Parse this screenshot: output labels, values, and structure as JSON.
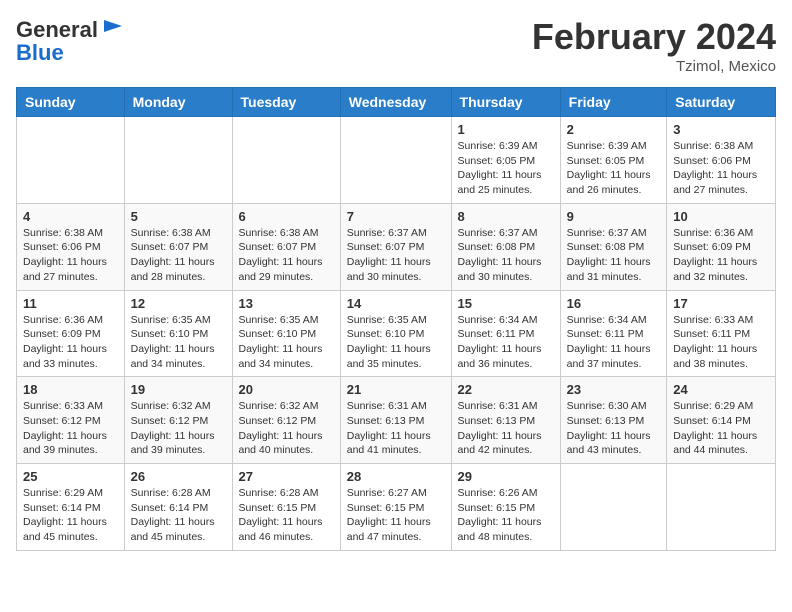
{
  "header": {
    "logo_general": "General",
    "logo_blue": "Blue",
    "month_title": "February 2024",
    "location": "Tzimol, Mexico"
  },
  "days_of_week": [
    "Sunday",
    "Monday",
    "Tuesday",
    "Wednesday",
    "Thursday",
    "Friday",
    "Saturday"
  ],
  "weeks": [
    [
      {
        "day": "",
        "content": ""
      },
      {
        "day": "",
        "content": ""
      },
      {
        "day": "",
        "content": ""
      },
      {
        "day": "",
        "content": ""
      },
      {
        "day": "1",
        "content": "Sunrise: 6:39 AM\nSunset: 6:05 PM\nDaylight: 11 hours and 25 minutes."
      },
      {
        "day": "2",
        "content": "Sunrise: 6:39 AM\nSunset: 6:05 PM\nDaylight: 11 hours and 26 minutes."
      },
      {
        "day": "3",
        "content": "Sunrise: 6:38 AM\nSunset: 6:06 PM\nDaylight: 11 hours and 27 minutes."
      }
    ],
    [
      {
        "day": "4",
        "content": "Sunrise: 6:38 AM\nSunset: 6:06 PM\nDaylight: 11 hours and 27 minutes."
      },
      {
        "day": "5",
        "content": "Sunrise: 6:38 AM\nSunset: 6:07 PM\nDaylight: 11 hours and 28 minutes."
      },
      {
        "day": "6",
        "content": "Sunrise: 6:38 AM\nSunset: 6:07 PM\nDaylight: 11 hours and 29 minutes."
      },
      {
        "day": "7",
        "content": "Sunrise: 6:37 AM\nSunset: 6:07 PM\nDaylight: 11 hours and 30 minutes."
      },
      {
        "day": "8",
        "content": "Sunrise: 6:37 AM\nSunset: 6:08 PM\nDaylight: 11 hours and 30 minutes."
      },
      {
        "day": "9",
        "content": "Sunrise: 6:37 AM\nSunset: 6:08 PM\nDaylight: 11 hours and 31 minutes."
      },
      {
        "day": "10",
        "content": "Sunrise: 6:36 AM\nSunset: 6:09 PM\nDaylight: 11 hours and 32 minutes."
      }
    ],
    [
      {
        "day": "11",
        "content": "Sunrise: 6:36 AM\nSunset: 6:09 PM\nDaylight: 11 hours and 33 minutes."
      },
      {
        "day": "12",
        "content": "Sunrise: 6:35 AM\nSunset: 6:10 PM\nDaylight: 11 hours and 34 minutes."
      },
      {
        "day": "13",
        "content": "Sunrise: 6:35 AM\nSunset: 6:10 PM\nDaylight: 11 hours and 34 minutes."
      },
      {
        "day": "14",
        "content": "Sunrise: 6:35 AM\nSunset: 6:10 PM\nDaylight: 11 hours and 35 minutes."
      },
      {
        "day": "15",
        "content": "Sunrise: 6:34 AM\nSunset: 6:11 PM\nDaylight: 11 hours and 36 minutes."
      },
      {
        "day": "16",
        "content": "Sunrise: 6:34 AM\nSunset: 6:11 PM\nDaylight: 11 hours and 37 minutes."
      },
      {
        "day": "17",
        "content": "Sunrise: 6:33 AM\nSunset: 6:11 PM\nDaylight: 11 hours and 38 minutes."
      }
    ],
    [
      {
        "day": "18",
        "content": "Sunrise: 6:33 AM\nSunset: 6:12 PM\nDaylight: 11 hours and 39 minutes."
      },
      {
        "day": "19",
        "content": "Sunrise: 6:32 AM\nSunset: 6:12 PM\nDaylight: 11 hours and 39 minutes."
      },
      {
        "day": "20",
        "content": "Sunrise: 6:32 AM\nSunset: 6:12 PM\nDaylight: 11 hours and 40 minutes."
      },
      {
        "day": "21",
        "content": "Sunrise: 6:31 AM\nSunset: 6:13 PM\nDaylight: 11 hours and 41 minutes."
      },
      {
        "day": "22",
        "content": "Sunrise: 6:31 AM\nSunset: 6:13 PM\nDaylight: 11 hours and 42 minutes."
      },
      {
        "day": "23",
        "content": "Sunrise: 6:30 AM\nSunset: 6:13 PM\nDaylight: 11 hours and 43 minutes."
      },
      {
        "day": "24",
        "content": "Sunrise: 6:29 AM\nSunset: 6:14 PM\nDaylight: 11 hours and 44 minutes."
      }
    ],
    [
      {
        "day": "25",
        "content": "Sunrise: 6:29 AM\nSunset: 6:14 PM\nDaylight: 11 hours and 45 minutes."
      },
      {
        "day": "26",
        "content": "Sunrise: 6:28 AM\nSunset: 6:14 PM\nDaylight: 11 hours and 45 minutes."
      },
      {
        "day": "27",
        "content": "Sunrise: 6:28 AM\nSunset: 6:15 PM\nDaylight: 11 hours and 46 minutes."
      },
      {
        "day": "28",
        "content": "Sunrise: 6:27 AM\nSunset: 6:15 PM\nDaylight: 11 hours and 47 minutes."
      },
      {
        "day": "29",
        "content": "Sunrise: 6:26 AM\nSunset: 6:15 PM\nDaylight: 11 hours and 48 minutes."
      },
      {
        "day": "",
        "content": ""
      },
      {
        "day": "",
        "content": ""
      }
    ]
  ]
}
